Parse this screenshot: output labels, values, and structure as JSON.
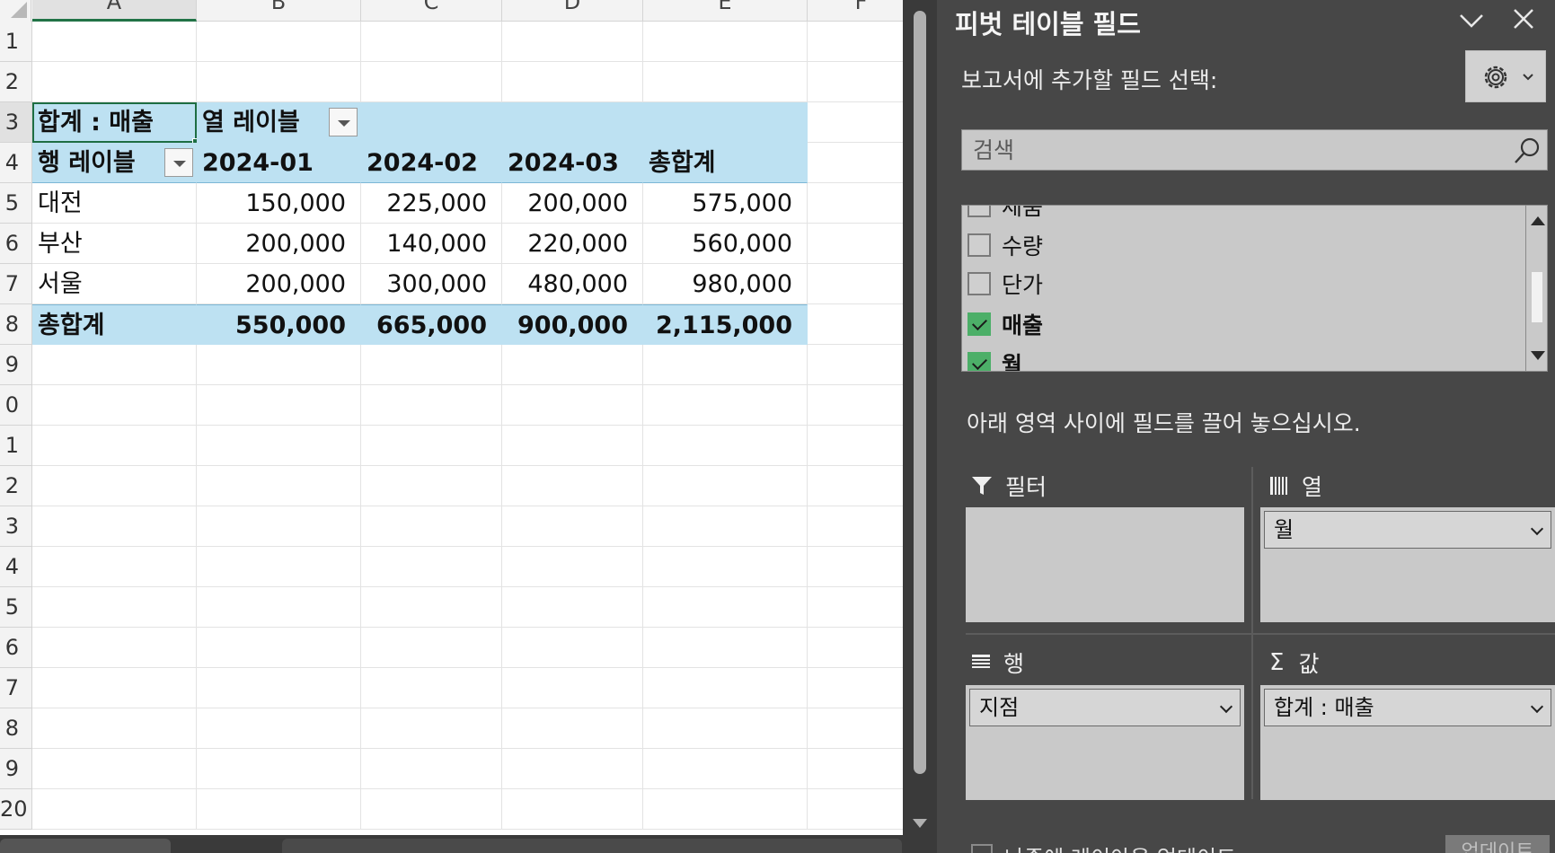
{
  "sheet": {
    "columns": [
      "A",
      "B",
      "C",
      "D",
      "E",
      "F"
    ],
    "rows": [
      "1",
      "2",
      "3",
      "4",
      "5",
      "6",
      "7",
      "8",
      "9",
      "0",
      "1",
      "2",
      "3",
      "4",
      "5",
      "6",
      "7",
      "8",
      "9",
      "20"
    ],
    "pivot": {
      "values_label": "합계 : 매출",
      "col_label": "열 레이블",
      "row_label": "행 레이블",
      "months": [
        "2024-01",
        "2024-02",
        "2024-03"
      ],
      "grand_total_header": "총합계",
      "data_rows": [
        {
          "name": "대전",
          "values": [
            "150,000",
            "225,000",
            "200,000",
            "575,000"
          ]
        },
        {
          "name": "부산",
          "values": [
            "200,000",
            "140,000",
            "220,000",
            "560,000"
          ]
        },
        {
          "name": "서울",
          "values": [
            "200,000",
            "300,000",
            "480,000",
            "980,000"
          ]
        }
      ],
      "total_row": {
        "name": "총합계",
        "values": [
          "550,000",
          "665,000",
          "900,000",
          "2,115,000"
        ]
      }
    }
  },
  "panel": {
    "title": "피벗 테이블 필드",
    "choose_label": "보고서에 추가할 필드 선택:",
    "search_placeholder": "검색",
    "fields": [
      {
        "label": "제품",
        "checked": false
      },
      {
        "label": "수량",
        "checked": false
      },
      {
        "label": "단가",
        "checked": false
      },
      {
        "label": "매출",
        "checked": true
      },
      {
        "label": "월",
        "checked": true
      }
    ],
    "drag_label": "아래 영역 사이에 필드를 끌어 놓으십시오.",
    "areas": {
      "filter": {
        "title": "필터",
        "items": []
      },
      "columns": {
        "title": "열",
        "items": [
          "월"
        ]
      },
      "rows": {
        "title": "행",
        "items": [
          "지점"
        ]
      },
      "values": {
        "title": "값",
        "items": [
          "합계 : 매출"
        ]
      }
    },
    "defer_label": "나중에 레이아웃 업데이트",
    "update_label": "업데이트"
  }
}
